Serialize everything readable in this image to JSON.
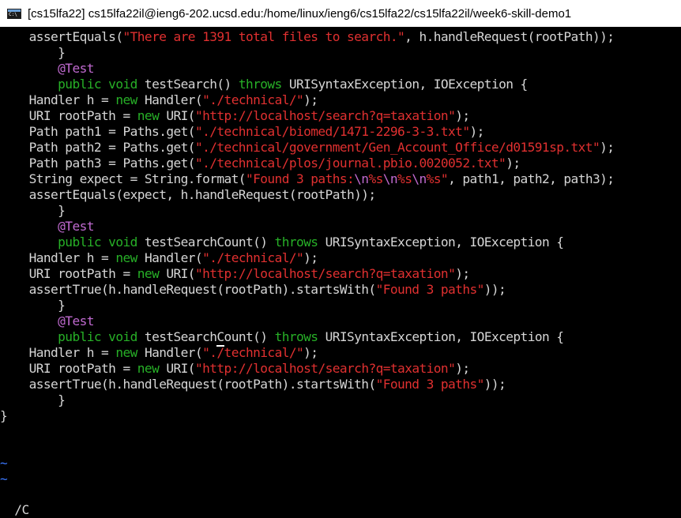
{
  "window": {
    "title": "[cs15lfa22]  cs15lfa22il@ieng6-202.ucsd.edu:/home/linux/ieng6/cs15lfa22/cs15lfa22il/week6-skill-demo1",
    "icon": "cmd-icon"
  },
  "editor": {
    "lines": [
      [
        {
          "t": "    assertEquals(",
          "c": "norm"
        },
        {
          "t": "\"There are 1391 total files to search.\"",
          "c": "str"
        },
        {
          "t": ", h.handleRequest(rootPath));",
          "c": "norm"
        }
      ],
      [
        {
          "t": "        }",
          "c": "norm"
        }
      ],
      [
        {
          "t": "        @Test",
          "c": "ann"
        }
      ],
      [
        {
          "t": "        public void ",
          "c": "kw"
        },
        {
          "t": "testSearch() ",
          "c": "norm"
        },
        {
          "t": "throws ",
          "c": "kw"
        },
        {
          "t": "URISyntaxException, IOException {",
          "c": "norm"
        }
      ],
      [
        {
          "t": "    Handler h = ",
          "c": "norm"
        },
        {
          "t": "new ",
          "c": "kw"
        },
        {
          "t": "Handler(",
          "c": "norm"
        },
        {
          "t": "\"./technical/\"",
          "c": "str"
        },
        {
          "t": ");",
          "c": "norm"
        }
      ],
      [
        {
          "t": "    URI rootPath = ",
          "c": "norm"
        },
        {
          "t": "new ",
          "c": "kw"
        },
        {
          "t": "URI(",
          "c": "norm"
        },
        {
          "t": "\"http://localhost/search?q=taxation\"",
          "c": "str"
        },
        {
          "t": ");",
          "c": "norm"
        }
      ],
      [
        {
          "t": "    Path path1 = Paths.get(",
          "c": "norm"
        },
        {
          "t": "\"./technical/biomed/1471-2296-3-3.txt\"",
          "c": "str"
        },
        {
          "t": ");",
          "c": "norm"
        }
      ],
      [
        {
          "t": "    Path path2 = Paths.get(",
          "c": "norm"
        },
        {
          "t": "\"./technical/government/Gen_Account_Office/d01591sp.txt\"",
          "c": "str"
        },
        {
          "t": ");",
          "c": "norm"
        }
      ],
      [
        {
          "t": "    Path path3 = Paths.get(",
          "c": "norm"
        },
        {
          "t": "\"./technical/plos/journal.pbio.0020052.txt\"",
          "c": "str"
        },
        {
          "t": ");",
          "c": "norm"
        }
      ],
      [
        {
          "t": "    String expect = String.format(",
          "c": "norm"
        },
        {
          "t": "\"Found 3 paths:",
          "c": "str"
        },
        {
          "t": "\\n",
          "c": "esc"
        },
        {
          "t": "%s",
          "c": "str"
        },
        {
          "t": "\\n",
          "c": "esc"
        },
        {
          "t": "%s",
          "c": "str"
        },
        {
          "t": "\\n",
          "c": "esc"
        },
        {
          "t": "%s\"",
          "c": "str"
        },
        {
          "t": ", path1, path2, path3);",
          "c": "norm"
        }
      ],
      [
        {
          "t": "    assertEquals(expect, h.handleRequest(rootPath));",
          "c": "norm"
        }
      ],
      [
        {
          "t": "        }",
          "c": "norm"
        }
      ],
      [
        {
          "t": "        @Test",
          "c": "ann"
        }
      ],
      [
        {
          "t": "        public void ",
          "c": "kw"
        },
        {
          "t": "testSearchCount() ",
          "c": "norm"
        },
        {
          "t": "throws ",
          "c": "kw"
        },
        {
          "t": "URISyntaxException, IOException {",
          "c": "norm"
        }
      ],
      [
        {
          "t": "    Handler h = ",
          "c": "norm"
        },
        {
          "t": "new ",
          "c": "kw"
        },
        {
          "t": "Handler(",
          "c": "norm"
        },
        {
          "t": "\"./technical/\"",
          "c": "str"
        },
        {
          "t": ");",
          "c": "norm"
        }
      ],
      [
        {
          "t": "    URI rootPath = ",
          "c": "norm"
        },
        {
          "t": "new ",
          "c": "kw"
        },
        {
          "t": "URI(",
          "c": "norm"
        },
        {
          "t": "\"http://localhost/search?q=taxation\"",
          "c": "str"
        },
        {
          "t": ");",
          "c": "norm"
        }
      ],
      [
        {
          "t": "    assertTrue(h.handleRequest(rootPath).startsWith(",
          "c": "norm"
        },
        {
          "t": "\"Found 3 paths\"",
          "c": "str"
        },
        {
          "t": "));",
          "c": "norm"
        }
      ],
      [
        {
          "t": "        }",
          "c": "norm"
        }
      ],
      [
        {
          "t": "        @Test",
          "c": "ann"
        }
      ],
      [
        {
          "t": "        public void ",
          "c": "kw"
        },
        {
          "t": "testSearch",
          "c": "norm"
        },
        {
          "t": "C",
          "c": "cursor"
        },
        {
          "t": "ount() ",
          "c": "norm"
        },
        {
          "t": "throws ",
          "c": "kw"
        },
        {
          "t": "URISyntaxException, IOException {",
          "c": "norm"
        }
      ],
      [
        {
          "t": "    Handler h = ",
          "c": "norm"
        },
        {
          "t": "new ",
          "c": "kw"
        },
        {
          "t": "Handler(",
          "c": "norm"
        },
        {
          "t": "\"./technical/\"",
          "c": "str"
        },
        {
          "t": ");",
          "c": "norm"
        }
      ],
      [
        {
          "t": "    URI rootPath = ",
          "c": "norm"
        },
        {
          "t": "new ",
          "c": "kw"
        },
        {
          "t": "URI(",
          "c": "norm"
        },
        {
          "t": "\"http://localhost/search?q=taxation\"",
          "c": "str"
        },
        {
          "t": ");",
          "c": "norm"
        }
      ],
      [
        {
          "t": "    assertTrue(h.handleRequest(rootPath).startsWith(",
          "c": "norm"
        },
        {
          "t": "\"Found 3 paths\"",
          "c": "str"
        },
        {
          "t": "));",
          "c": "norm"
        }
      ],
      [
        {
          "t": "        }",
          "c": "norm"
        }
      ],
      [
        {
          "t": "}",
          "c": "norm"
        }
      ],
      [],
      [],
      [
        {
          "t": "~",
          "c": "tilde"
        }
      ],
      [
        {
          "t": "~",
          "c": "tilde"
        }
      ]
    ],
    "command_line": "/C"
  },
  "colors": {
    "background": "#000000",
    "normal_text": "#d6d6d6",
    "string": "#e03030",
    "keyword": "#27b027",
    "annotation": "#c06ad0",
    "tilde": "#3b78ff"
  }
}
